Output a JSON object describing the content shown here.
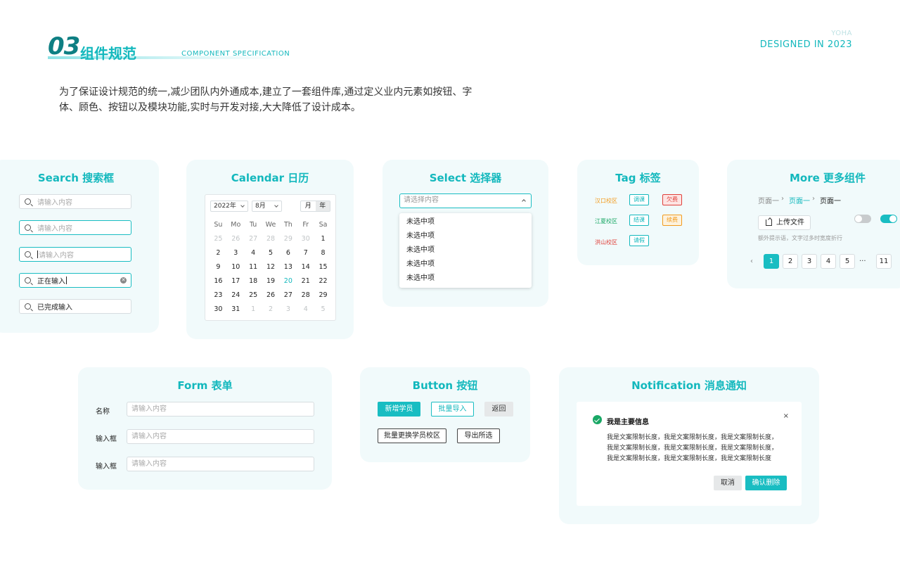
{
  "header": {
    "number": "03",
    "title": "组件规范",
    "subtitle_en": "COMPONENT SPECIFICATION",
    "brand_small": "YOHA",
    "brand_main": "DESIGNED IN  2023",
    "intro_line1": "为了保证设计规范的统一,减少团队内外通成本,建立了一套组件库,通过定义业内元素如按钮、字",
    "intro_line2": "体、顾色、按钮以及模块功能,实时与开发对接,大大降低了设计成本。"
  },
  "search": {
    "title": "Search 搜索框",
    "placeholder": "请输入内容",
    "typing_value": "正在输入",
    "done_value": "已完成输入"
  },
  "calendar": {
    "title": "Calendar 日历",
    "year": "2022年",
    "month": "8月",
    "mode_month": "月",
    "mode_year": "年",
    "weekdays": [
      "Su",
      "Mo",
      "Tu",
      "We",
      "Th",
      "Fr",
      "Sa"
    ],
    "days": [
      {
        "d": "25",
        "m": true
      },
      {
        "d": "26",
        "m": true
      },
      {
        "d": "27",
        "m": true
      },
      {
        "d": "28",
        "m": true
      },
      {
        "d": "29",
        "m": true
      },
      {
        "d": "30",
        "m": true
      },
      {
        "d": "1"
      },
      {
        "d": "2"
      },
      {
        "d": "3"
      },
      {
        "d": "4"
      },
      {
        "d": "5"
      },
      {
        "d": "6"
      },
      {
        "d": "7"
      },
      {
        "d": "8"
      },
      {
        "d": "9"
      },
      {
        "d": "10"
      },
      {
        "d": "11"
      },
      {
        "d": "12"
      },
      {
        "d": "13"
      },
      {
        "d": "14"
      },
      {
        "d": "15"
      },
      {
        "d": "16"
      },
      {
        "d": "17"
      },
      {
        "d": "18"
      },
      {
        "d": "19"
      },
      {
        "d": "20",
        "t": true
      },
      {
        "d": "21"
      },
      {
        "d": "22"
      },
      {
        "d": "23"
      },
      {
        "d": "24"
      },
      {
        "d": "25"
      },
      {
        "d": "26"
      },
      {
        "d": "27"
      },
      {
        "d": "28"
      },
      {
        "d": "29"
      },
      {
        "d": "30"
      },
      {
        "d": "31"
      },
      {
        "d": "1",
        "m": true
      },
      {
        "d": "2",
        "m": true
      },
      {
        "d": "3",
        "m": true
      },
      {
        "d": "4",
        "m": true
      },
      {
        "d": "5",
        "m": true
      }
    ]
  },
  "select": {
    "title": "Select 选择器",
    "placeholder": "请选择内容",
    "options": [
      "未选中项",
      "未选中项",
      "未选中项",
      "未选中项",
      "未选中项"
    ]
  },
  "tag": {
    "title": "Tag 标签",
    "campus": [
      "汉口校区",
      "江夏校区",
      "洪山校区"
    ],
    "tags": [
      "调课",
      "结课",
      "请假",
      "欠费",
      "续费"
    ],
    "colors": {
      "orange": "#f29b1d",
      "green": "#1aa866",
      "red": "#e0403a",
      "teal": "#13b8bd"
    }
  },
  "more": {
    "title": "More 更多组件",
    "breadcrumb": [
      "页面一",
      "页面一",
      "页面一"
    ],
    "upload_label": "上传文件",
    "hint": "额外提示语，文字过多时宽度折行",
    "switch_off": false,
    "switch_on": true,
    "pages": [
      "1",
      "2",
      "3",
      "4",
      "5",
      "11"
    ],
    "ellipsis": "···",
    "prev": "‹"
  },
  "form": {
    "title": "Form 表单",
    "labels": [
      "名称",
      "输入框",
      "输入框"
    ],
    "placeholder": "请输入内容"
  },
  "button": {
    "title": "Button 按钮",
    "add_student": "新增学员",
    "batch_import": "批量导入",
    "back": "返回",
    "batch_change": "批量更换学员校区",
    "export_selected": "导出所选"
  },
  "notification": {
    "title": "Notification 消息通知",
    "msg_title": "我是主要信息",
    "close": "×",
    "body_line1": "我是文案限制长度，我是文案限制长度，我是文案限制长度，",
    "body_line2": "我是文案限制长度，我是文案限制长度，我是文案限制长度，",
    "body_line3": "我是文案限制长度，我是文案限制长度，我是文案限制长度",
    "cancel": "取消",
    "confirm_delete": "确认删除"
  },
  "colors": {
    "accent": "#13b8bd",
    "accent_dark": "#0e7f83",
    "card_bg": "#f1fafb"
  }
}
